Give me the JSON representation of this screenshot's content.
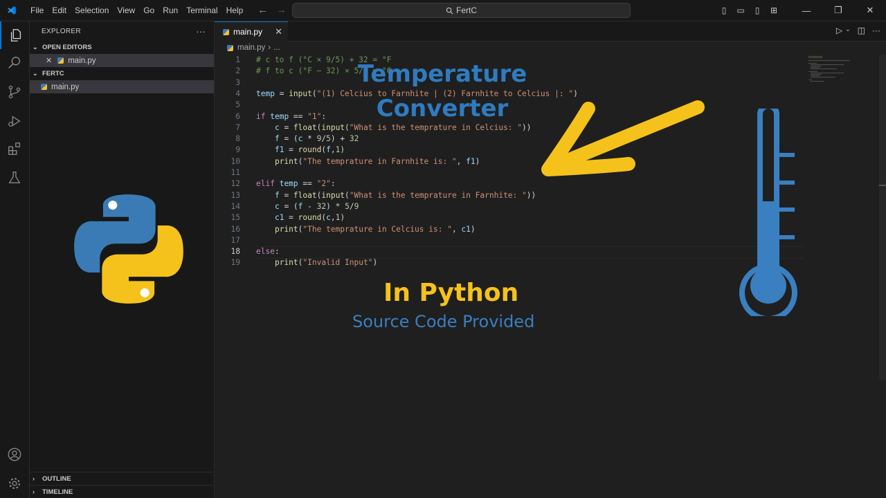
{
  "menu": [
    "File",
    "Edit",
    "Selection",
    "View",
    "Go",
    "Run",
    "Terminal",
    "Help"
  ],
  "command_center": "FertC",
  "explorer": {
    "title": "EXPLORER",
    "more": "···",
    "open_editors": "OPEN EDITORS",
    "open_file": "main.py",
    "folder": "FERTC",
    "folder_file": "main.py",
    "outline": "OUTLINE",
    "timeline": "TIMELINE"
  },
  "tab": {
    "label": "main.py",
    "close": "✕"
  },
  "breadcrumb": {
    "file": "main.py",
    "sep": "›",
    "more": "..."
  },
  "code_lines": [
    "# c to f (°C × 9/5) + 32 = °F",
    "# f to c (°F − 32) × 5/9 = °C",
    "",
    "temp = input(\"(1) Celcius to Farnhite | (2) Farnhite to Celcius |: \")",
    "",
    "if temp == \"1\":",
    "    c = float(input(\"What is the temprature in Celcius: \"))",
    "    f = (c * 9/5) + 32",
    "    f1 = round(f,1)",
    "    print(\"The temprature in Farnhite is: \", f1)",
    "",
    "elif temp == \"2\":",
    "    f = float(input(\"What is the temprature in Farnhite: \"))",
    "    c = (f - 32) * 5/9",
    "    c1 = round(c,1)",
    "    print(\"The temprature in Celcius is: \", c1)",
    "",
    "else:",
    "    print(\"Invalid Input\")"
  ],
  "active_line": 18,
  "overlay": {
    "title_line1": "Temperature",
    "title_line2": "Converter",
    "language": "In Python",
    "subtitle": "Source Code Provided"
  },
  "colors": {
    "accent": "#0078d4",
    "python_blue": "#3a7fc0",
    "python_yellow": "#f5c21b"
  }
}
